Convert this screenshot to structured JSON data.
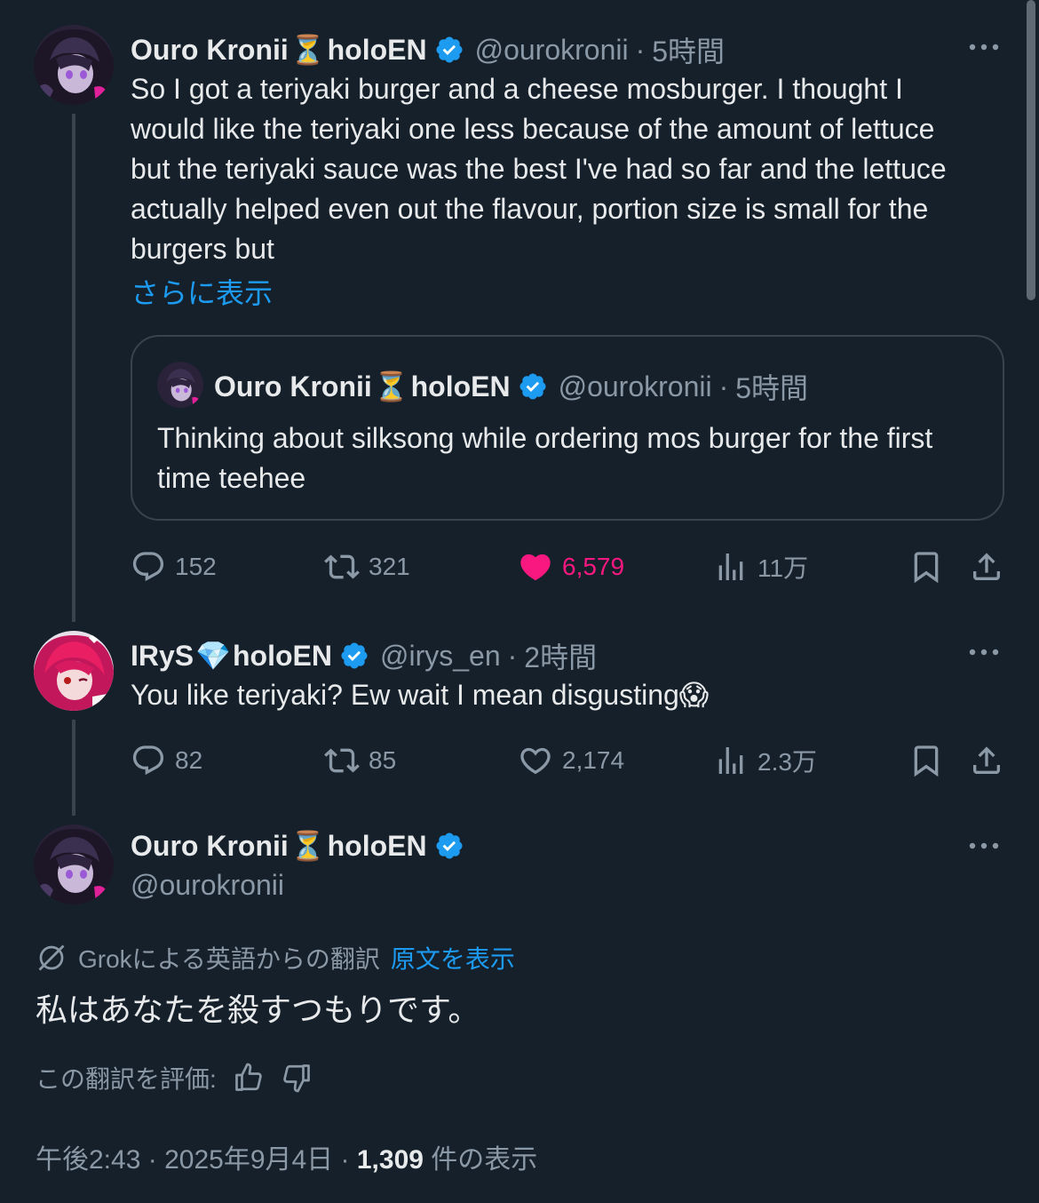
{
  "colors": {
    "background": "#15202b",
    "text": "#e7e9ea",
    "secondary": "#8b98a5",
    "accent": "#1d9bf0",
    "like": "#f91880",
    "border": "#38444d"
  },
  "tweet1": {
    "display_name": "Ouro Kronii",
    "emoji": "⏳",
    "display_suffix": "holoEN",
    "handle": "@ourokronii",
    "sep": "·",
    "time": "5時間",
    "text": "So I got a teriyaki burger and a cheese mosburger. I thought I would like the teriyaki one less because of the amount of lettuce but the teriyaki sauce was the best I've had so far and the lettuce actually helped even out the flavour, portion size is small for the burgers but",
    "show_more": "さらに表示",
    "quote": {
      "display_name": "Ouro Kronii",
      "emoji": "⏳",
      "display_suffix": "holoEN",
      "handle": "@ourokronii",
      "sep": "·",
      "time": "5時間",
      "text": "Thinking about silksong while ordering mos burger for the first time teehee"
    },
    "actions": {
      "replies": "152",
      "retweets": "321",
      "likes": "6,579",
      "views": "11万"
    }
  },
  "tweet2": {
    "display_name": "IRyS",
    "emoji": "💎",
    "display_suffix": "holoEN",
    "handle": "@irys_en",
    "sep": "·",
    "time": "2時間",
    "text": "You like teriyaki? Ew wait I mean disgusting",
    "text_emoji": "😱",
    "actions": {
      "replies": "82",
      "retweets": "85",
      "likes": "2,174",
      "views": "2.3万"
    }
  },
  "tweet3": {
    "display_name": "Ouro Kronii",
    "emoji": "⏳",
    "display_suffix": "holoEN",
    "handle": "@ourokronii",
    "translation_label": "Grokによる英語からの翻訳",
    "show_original": "原文を表示",
    "translated_text": "私はあなたを殺すつもりです。",
    "rate_label": "この翻訳を評価:",
    "time": "午後2:43",
    "sep": "·",
    "date": "2025年9月4日",
    "views_count": "1,309",
    "views_label": "件の表示"
  }
}
